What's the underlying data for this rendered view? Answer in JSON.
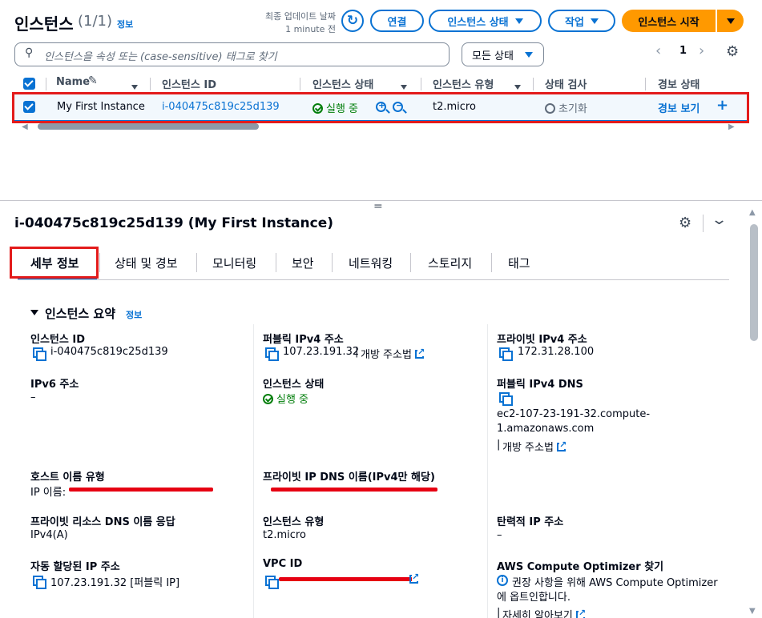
{
  "header": {
    "title": "인스턴스",
    "count": "(1/1)",
    "info": "정보",
    "last_updated_label": "최종 업데이트 날짜",
    "last_updated_value": "1 minute 전",
    "connect": "연결",
    "instance_state": "인스턴스 상태",
    "actions": "작업",
    "launch": "인스턴스 시작"
  },
  "search": {
    "placeholder": "인스턴스을 속성 또는 (case-sensitive) 태그로 찾기",
    "state_filter": "모든 상태",
    "page": "1"
  },
  "table": {
    "columns": [
      "Name",
      "인스턴스 ID",
      "인스턴스 상태",
      "인스턴스 유형",
      "상태 검사",
      "경보 상태"
    ],
    "row": {
      "name": "My First Instance",
      "id": "i-040475c819c25d139",
      "state": "실행 중",
      "type": "t2.micro",
      "status_check": "초기화",
      "alarm": "경보 보기",
      "add": "+"
    }
  },
  "detail": {
    "title": "i-040475c819c25d139 (My First Instance)",
    "tabs": [
      "세부 정보",
      "상태 및 경보",
      "모니터링",
      "보안",
      "네트워킹",
      "스토리지",
      "태그"
    ],
    "section_title": "인스턴스 요약",
    "section_info": "정보",
    "fields": {
      "instance_id_label": "인스턴스 ID",
      "instance_id_value": "i-040475c819c25d139",
      "public_ipv4_label": "퍼블릭 IPv4 주소",
      "public_ipv4_value": "107.23.191.32",
      "open_address": "개방 주소법",
      "private_ipv4_label": "프라이빗 IPv4 주소",
      "private_ipv4_value": "172.31.28.100",
      "ipv6_label": "IPv6 주소",
      "ipv6_value": "–",
      "state_label": "인스턴스 상태",
      "state_value": "실행 중",
      "public_dns_label": "퍼블릭 IPv4 DNS",
      "public_dns_value_1": "ec2-107-23-191-32.compute-",
      "public_dns_value_2": "1.amazonaws.com",
      "public_dns_open": "개방 주소법",
      "hostname_type_label": "호스트 이름 유형",
      "hostname_type_value": "IP 이름:",
      "private_dns_label": "프라이빗 IP DNS 이름(IPv4만 해당)",
      "private_resource_dns_label": "프라이빗 리소스 DNS 이름 응답",
      "private_resource_dns_value": "IPv4(A)",
      "instance_type_label": "인스턴스 유형",
      "instance_type_value": "t2.micro",
      "elastic_ip_label": "탄력적 IP 주소",
      "elastic_ip_value": "–",
      "auto_ip_label": "자동 할당된 IP 주소",
      "auto_ip_value": "107.23.191.32 [퍼블릭 IP]",
      "vpc_id_label": "VPC ID",
      "optimizer_label": "AWS Compute Optimizer 찾기",
      "optimizer_text_1": "권장 사항을 위해 AWS Compute Optimizer",
      "optimizer_text_2": "에 옵트인합니다.",
      "learn_more": "자세히 알아보기"
    }
  },
  "colors": {
    "accent": "#0972d3",
    "launch_button": "#ff9900",
    "running": "#037f0c",
    "highlight": "#e31b1b"
  }
}
